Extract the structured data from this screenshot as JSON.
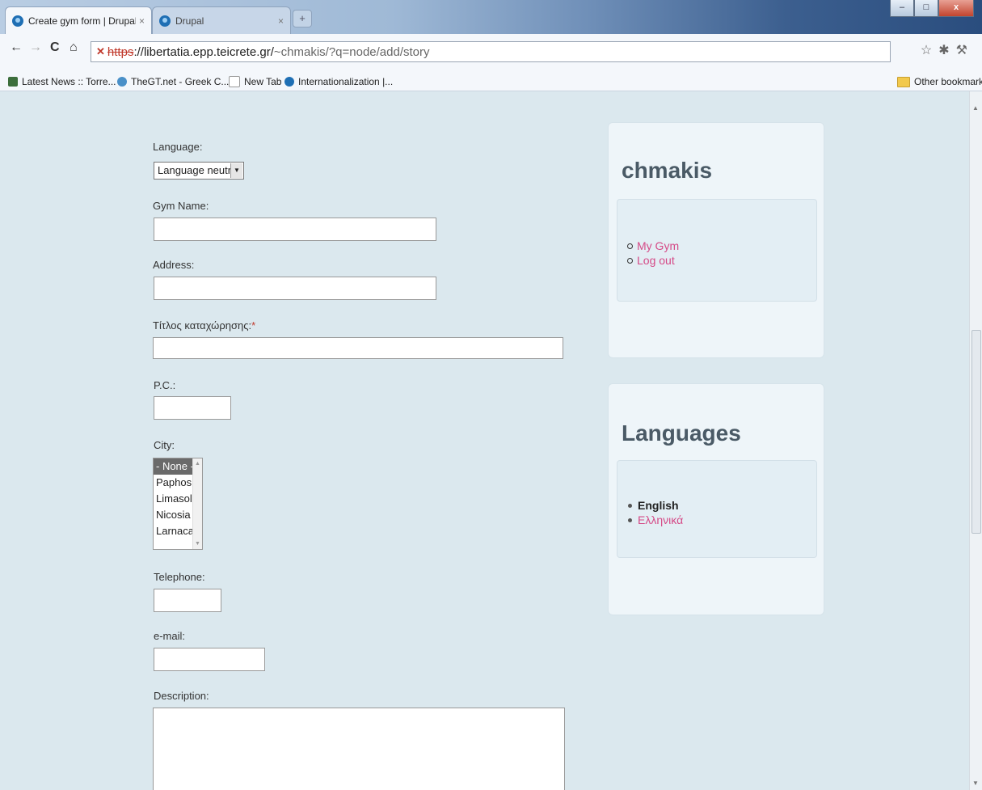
{
  "browser": {
    "tabs": [
      {
        "title": "Create gym form | Drupal",
        "active": true
      },
      {
        "title": "Drupal",
        "active": false
      }
    ],
    "url": {
      "scheme": "https",
      "rest": "://libertatia.epp.teicrete.gr/",
      "path": "~chmakis/?q=node/add/story"
    },
    "bookmarks": [
      {
        "label": "Latest News :: Torre..."
      },
      {
        "label": "TheGT.net - Greek C..."
      },
      {
        "label": "New Tab"
      },
      {
        "label": "Internationalization |..."
      }
    ],
    "other_bookmarks": "Other bookmarks"
  },
  "form": {
    "language": {
      "label": "Language:",
      "value": "Language neutral"
    },
    "gym_name": {
      "label": "Gym Name:"
    },
    "address": {
      "label": "Address:"
    },
    "title": {
      "label": "Τίτλος καταχώρησης:",
      "required_mark": "*"
    },
    "pc": {
      "label": "P.C.:"
    },
    "city": {
      "label": "City:",
      "options": [
        "- None -",
        "Paphos",
        "Limasol",
        "Nicosia",
        "Larnaca"
      ],
      "selected": "- None -"
    },
    "telephone": {
      "label": "Telephone:"
    },
    "email": {
      "label": "e-mail:"
    },
    "description": {
      "label": "Description:"
    }
  },
  "sidebar": {
    "user_block": {
      "title": "chmakis",
      "links": [
        "My Gym",
        "Log out"
      ]
    },
    "languages_block": {
      "title": "Languages",
      "items": [
        {
          "label": "English",
          "active": true
        },
        {
          "label": "Ελληνικά",
          "active": false
        }
      ]
    }
  },
  "colors": {
    "link": "#d54a87",
    "page_bg": "#dbe8ee",
    "required": "#c0392b"
  }
}
